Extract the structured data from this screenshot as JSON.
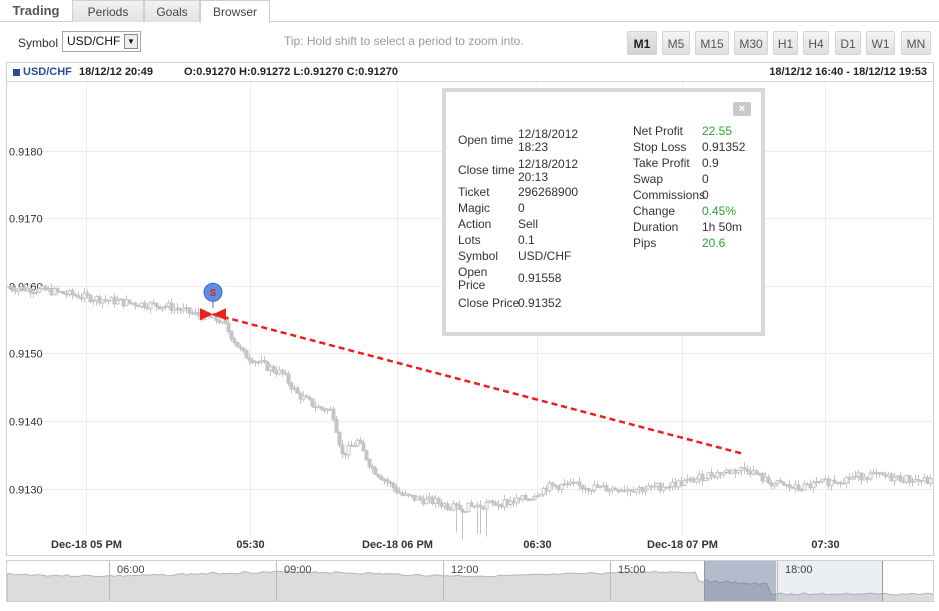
{
  "tabs": [
    {
      "label": "Trading",
      "active": false
    },
    {
      "label": "Periods",
      "active": false
    },
    {
      "label": "Goals",
      "active": false
    },
    {
      "label": "Browser",
      "active": true
    }
  ],
  "toolbar": {
    "symbol_label": "Symbol",
    "symbol_value": "USD/CHF",
    "tip": "Tip: Hold shift to select a period to zoom into.",
    "periods": [
      "M1",
      "M5",
      "M15",
      "M30",
      "H1",
      "H4",
      "D1",
      "W1",
      "MN"
    ],
    "active_period": "M1"
  },
  "chart_header": {
    "symbol": "USD/CHF",
    "time": "18/12/12 20:49",
    "ohlc": "O:0.91270 H:0.91272 L:0.91270 C:0.91270",
    "range": "18/12/12 16:40 - 18/12/12 19:53"
  },
  "chart_data": {
    "type": "candlestick",
    "symbol": "USD/CHF",
    "y_ticks": [
      "0.9180",
      "0.9170",
      "0.9160",
      "0.9150",
      "0.9140",
      "0.9130"
    ],
    "ylim": [
      0.9123,
      0.919
    ],
    "x_ticks": [
      "Dec-18 05 PM",
      "05:30",
      "Dec-18 06 PM",
      "06:30",
      "Dec-18 07 PM",
      "07:30"
    ],
    "grid": true,
    "series_color": "#c4c4c4",
    "close_profile": [
      [
        0,
        0.91598
      ],
      [
        40,
        0.91593
      ],
      [
        80,
        0.91583
      ],
      [
        120,
        0.91575
      ],
      [
        160,
        0.9157
      ],
      [
        190,
        0.91557
      ],
      [
        215,
        0.91548
      ],
      [
        235,
        0.915
      ],
      [
        260,
        0.9148
      ],
      [
        275,
        0.9147
      ],
      [
        290,
        0.9144
      ],
      [
        310,
        0.9142
      ],
      [
        325,
        0.91415
      ],
      [
        335,
        0.9135
      ],
      [
        350,
        0.9137
      ],
      [
        365,
        0.9133
      ],
      [
        380,
        0.9131
      ],
      [
        395,
        0.9129
      ],
      [
        410,
        0.91285
      ],
      [
        430,
        0.9128
      ],
      [
        450,
        0.9127
      ],
      [
        470,
        0.91275
      ],
      [
        500,
        0.9128
      ],
      [
        520,
        0.91285
      ],
      [
        540,
        0.91303
      ],
      [
        560,
        0.91305
      ],
      [
        600,
        0.913
      ],
      [
        640,
        0.913
      ],
      [
        680,
        0.9131
      ],
      [
        700,
        0.9132
      ],
      [
        720,
        0.91325
      ],
      [
        740,
        0.9133
      ],
      [
        760,
        0.9131
      ],
      [
        790,
        0.913
      ],
      [
        820,
        0.9131
      ],
      [
        860,
        0.9132
      ],
      [
        926,
        0.9131
      ]
    ],
    "trade": {
      "marker": "S",
      "open_price": 0.91558,
      "close_price": 0.91352,
      "line_color": "#e8211c"
    }
  },
  "info_panel": {
    "close_glyph": "×",
    "left_rows": [
      {
        "label": "Open time",
        "value": "12/18/2012\n18:23"
      },
      {
        "label": "Close time",
        "value": "12/18/2012\n20:13"
      },
      {
        "label": "Ticket",
        "value": "296268900"
      },
      {
        "label": "Magic",
        "value": "0"
      },
      {
        "label": "Action",
        "value": "Sell"
      },
      {
        "label": "Lots",
        "value": "0.1"
      },
      {
        "label": "Symbol",
        "value": "USD/CHF"
      },
      {
        "label": "Open\nPrice",
        "value": "0.91558"
      },
      {
        "label": "Close Price",
        "value": "0.91352"
      }
    ],
    "right_rows": [
      {
        "label": "Net Profit",
        "value": "22.55",
        "green": true
      },
      {
        "label": "Stop Loss",
        "value": "0.91352",
        "green": false
      },
      {
        "label": "Take Profit",
        "value": "0.9",
        "green": false
      },
      {
        "label": "Swap",
        "value": "0",
        "green": false
      },
      {
        "label": "Commissions",
        "value": "0",
        "green": false
      },
      {
        "label": "Change",
        "value": "0.45%",
        "green": true
      },
      {
        "label": "Duration",
        "value": "1h 50m",
        "green": false
      },
      {
        "label": "Pips",
        "value": "20.6",
        "green": true
      }
    ]
  },
  "navigator": {
    "labels": [
      "06:00",
      "09:00",
      "12:00",
      "15:00",
      "18:00"
    ]
  }
}
